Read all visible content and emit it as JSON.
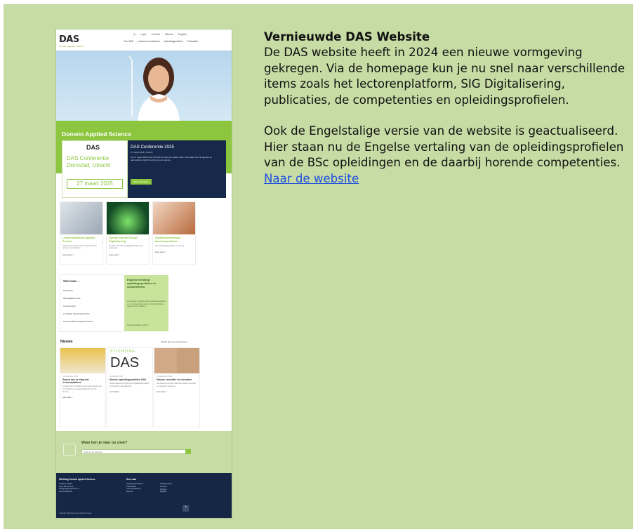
{
  "article": {
    "title": "Vernieuwde DAS Website",
    "paragraph1": "De DAS website heeft in 2024 een nieuwe vormgeving gekregen. Via de homepage kun je nu snel naar verschillende items zoals het lectorenplatform, SIG Digitalisering, publicaties, de competenties en opleidingsprofielen.",
    "paragraph2": "Ook de Engelstalige versie van de website is geactualiseerd. Hier staan nu de Engelse vertaling van de opleidingsprofielen van de BSc opleidingen en de daarbij horende competenties.",
    "link": "Naar de website"
  },
  "site": {
    "logo": "DAS",
    "logo_tag": "domein applied science",
    "nav_top": [
      "Q",
      "Login",
      "Contact",
      "Nieuws",
      "English"
    ],
    "nav_main": [
      "Over DAS",
      "Lectoren & onderzoek",
      "Opleidingsprofielen",
      "Publicaties"
    ],
    "hero_title": "Domein Applied Science",
    "hero_sub": "Kwalitatief hoogstaand hbo Applied Science onderwijs en onderzoek afgestemd op het werkveld",
    "conf_logo": "DAS",
    "conf_title": "DAS Conferentie",
    "conf_place": "Domstad, Utrecht",
    "conf_date": "27 maart 2025",
    "conf_right_title": "DAS Conferentie 2025",
    "conf_right_sub": "27 maart 2025 | Utrecht",
    "conf_right_text": "Op 27 maart 2025 vindt de DAS Conferentie plaats. Meer informatie over de agenda en aanmelding volgt binnenkort op de website.",
    "conf_right_btn": "Meer informatie",
    "cards": [
      {
        "title": "Lectorenplatform Applied Science",
        "desc": "Alle lectoren binnen het domein werken samen in dit platform.",
        "more": "Lees meer >"
      },
      {
        "title": "Special Interest Group Digitalisering",
        "desc": "De SIG richt zich op digitalisering in het onderwijs.",
        "more": "Lees meer >"
      },
      {
        "title": "Studiekeuzewebsite bachelorprofielen",
        "desc": "Alle opleidingsprofielen op een rij.",
        "more": "Lees meer >"
      }
    ],
    "snel_title": "Snel naar ...",
    "snel_items": [
      "Publicaties",
      "Werkplaatsen DAS",
      "Competenties",
      "Landelijke opleidingsprofielen",
      "Lectorenplatform Applied Science"
    ],
    "eng_title": "Engelse vertaling opleidingsprofielen en competenties",
    "eng_text": "De Engelse vertaling van de opleidingsprofielen en de competenties staan op de Engelstalige pagina van de website.",
    "eng_more": "Naar Engelstalige website >",
    "news_title": "Nieuws",
    "news_all": "Bekijk alle nieuwsberichten >",
    "news": [
      {
        "date": "12 november 2024",
        "title": "Samen aan de slag met lectorenplatform",
        "desc": "Lectoren van het platform ontmoeten elkaar voor kennisdeling en samenwerking binnen het domein.",
        "more": "Lees meer >"
      },
      {
        "date": "01 oktober 2024",
        "title": "Nieuwe opleidingsprofielen DAS",
        "desc": "Vanaf september 2024 zijn de opleidingsprofielen vernieuwd en gepubliceerd.",
        "more": "Lees meer >"
      },
      {
        "date": "15 september 2024",
        "title": "Nieuwe voorzitter en secretaris",
        "desc": "Het bestuur van DAS heeft een nieuwe voorzitter en secretaris benoemd.",
        "more": "Lees meer >"
      }
    ],
    "news2_logo": "DAS",
    "news2_top": "STICHTING",
    "search_title": "Waar ben je naar op zoek?",
    "search_placeholder": "Zoek op de website...",
    "footer": {
      "col1_title": "Stichting Domein Applied Science",
      "col1_lines": [
        "Postbus 12345",
        "1234 AB Utrecht",
        "info@appliedscience.nl",
        "KvK 12345678"
      ],
      "col2_title": "Snel naar",
      "col2_lines": [
        "Opleidingsprofielen",
        "Publicaties",
        "Lectorenplatform",
        "Nieuws"
      ],
      "col3_lines": [
        "Werkplaatsen",
        "Contact",
        "Privacy",
        "English"
      ],
      "copy": "Copyright Stichting Domein Applied Science"
    }
  },
  "colors": {
    "frame": "#c6dca4",
    "brand_green": "#8cc63f",
    "navy": "#17294a",
    "link": "#1f4fe0"
  }
}
